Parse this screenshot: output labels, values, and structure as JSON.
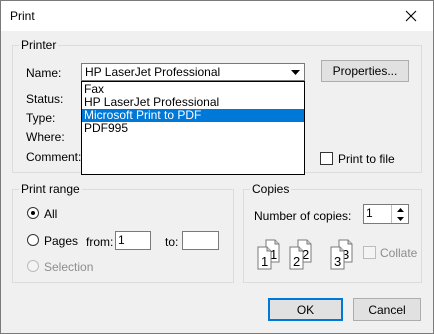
{
  "window": {
    "title": "Print",
    "close_icon": "close-icon"
  },
  "printer": {
    "group_label": "Printer",
    "name_label": "Name:",
    "selected_name": "HP LaserJet Professional",
    "status_label": "Status:",
    "type_label": "Type:",
    "where_label": "Where:",
    "comment_label": "Comment:",
    "properties_button": "Properties...",
    "print_to_file_label": "Print to file",
    "print_to_file_checked": false,
    "dropdown_items": [
      {
        "label": "Fax",
        "selected": false
      },
      {
        "label": "HP LaserJet Professional",
        "selected": false
      },
      {
        "label": "Microsoft Print to PDF",
        "selected": true
      },
      {
        "label": "PDF995",
        "selected": false
      }
    ]
  },
  "print_range": {
    "group_label": "Print range",
    "all_label": "All",
    "pages_label": "Pages",
    "from_label": "from:",
    "from_value": "1",
    "to_label": "to:",
    "to_value": "",
    "selection_label": "Selection",
    "selected": "all"
  },
  "copies": {
    "group_label": "Copies",
    "number_label": "Number of copies:",
    "number_value": "1",
    "collate_label": "Collate",
    "collate_checked": false
  },
  "buttons": {
    "ok": "OK",
    "cancel": "Cancel"
  },
  "colors": {
    "selection": "#0078d7",
    "face": "#f0f0f0",
    "disabled_text": "#8d8d8d"
  }
}
